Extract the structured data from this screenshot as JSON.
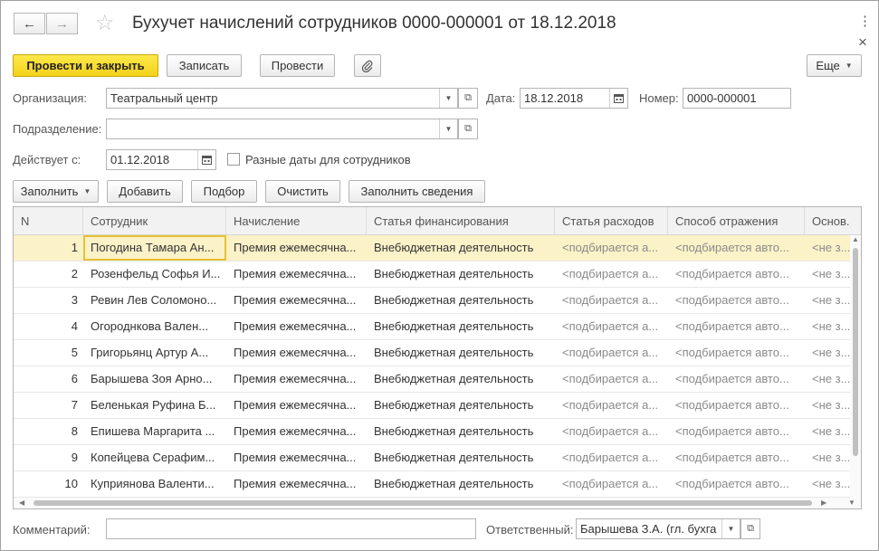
{
  "window": {
    "title": "Бухучет начислений сотрудников 0000-000001 от 18.12.2018",
    "back_icon": "←",
    "forward_icon": "→",
    "more_icon": "⋮",
    "close_icon": "×"
  },
  "toolbar": {
    "post_close": "Провести и закрыть",
    "save": "Записать",
    "post": "Провести",
    "more": "Еще"
  },
  "form": {
    "org_label": "Организация:",
    "org_value": "Театральный центр",
    "date_label": "Дата:",
    "date_value": "18.12.2018",
    "number_label": "Номер:",
    "number_value": "0000-000001",
    "dept_label": "Подразделение:",
    "dept_value": "",
    "valid_from_label": "Действует с:",
    "valid_from_value": "01.12.2018",
    "different_dates_label": "Разные даты для сотрудников"
  },
  "table_toolbar": {
    "fill": "Заполнить",
    "add": "Добавить",
    "pick": "Подбор",
    "clear": "Очистить",
    "fill_info": "Заполнить сведения"
  },
  "table": {
    "columns": [
      "N",
      "Сотрудник",
      "Начисление",
      "Статья финансирования",
      "Статья расходов",
      "Способ отражения",
      "Основ..."
    ],
    "rows": [
      {
        "n": "1",
        "employee": "Погодина Тамара Ан...",
        "accrual": "Премия ежемесячна...",
        "funding": "Внебюджетная деятельность",
        "expense": "<подбирается а...",
        "method": "<подбирается авто...",
        "basis": "<не з..."
      },
      {
        "n": "2",
        "employee": "Розенфельд Софья И...",
        "accrual": "Премия ежемесячна...",
        "funding": "Внебюджетная деятельность",
        "expense": "<подбирается а...",
        "method": "<подбирается авто...",
        "basis": "<не з..."
      },
      {
        "n": "3",
        "employee": "Ревин Лев Соломоно...",
        "accrual": "Премия ежемесячна...",
        "funding": "Внебюджетная деятельность",
        "expense": "<подбирается а...",
        "method": "<подбирается авто...",
        "basis": "<не з..."
      },
      {
        "n": "4",
        "employee": "Огороднкова Вален...",
        "accrual": "Премия ежемесячна...",
        "funding": "Внебюджетная деятельность",
        "expense": "<подбирается а...",
        "method": "<подбирается авто...",
        "basis": "<не з..."
      },
      {
        "n": "5",
        "employee": "Григорьянц Артур А...",
        "accrual": "Премия ежемесячна...",
        "funding": "Внебюджетная деятельность",
        "expense": "<подбирается а...",
        "method": "<подбирается авто...",
        "basis": "<не з..."
      },
      {
        "n": "6",
        "employee": "Барышева Зоя Арно...",
        "accrual": "Премия ежемесячна...",
        "funding": "Внебюджетная деятельность",
        "expense": "<подбирается а...",
        "method": "<подбирается авто...",
        "basis": "<не з..."
      },
      {
        "n": "7",
        "employee": "Беленькая Руфина Б...",
        "accrual": "Премия ежемесячна...",
        "funding": "Внебюджетная деятельность",
        "expense": "<подбирается а...",
        "method": "<подбирается авто...",
        "basis": "<не з..."
      },
      {
        "n": "8",
        "employee": "Епишева Маргарита ...",
        "accrual": "Премия ежемесячна...",
        "funding": "Внебюджетная деятельность",
        "expense": "<подбирается а...",
        "method": "<подбирается авто...",
        "basis": "<не з..."
      },
      {
        "n": "9",
        "employee": "Копейцева Серафим...",
        "accrual": "Премия ежемесячна...",
        "funding": "Внебюджетная деятельность",
        "expense": "<подбирается а...",
        "method": "<подбирается авто...",
        "basis": "<не з..."
      },
      {
        "n": "10",
        "employee": "Куприянова Валенти...",
        "accrual": "Премия ежемесячна...",
        "funding": "Внебюджетная деятельность",
        "expense": "<подбирается а...",
        "method": "<подбирается авто...",
        "basis": "<не з..."
      }
    ]
  },
  "footer": {
    "comment_label": "Комментарий:",
    "comment_value": "",
    "responsible_label": "Ответственный:",
    "responsible_value": "Барышева З.А. (гл. бухга"
  }
}
